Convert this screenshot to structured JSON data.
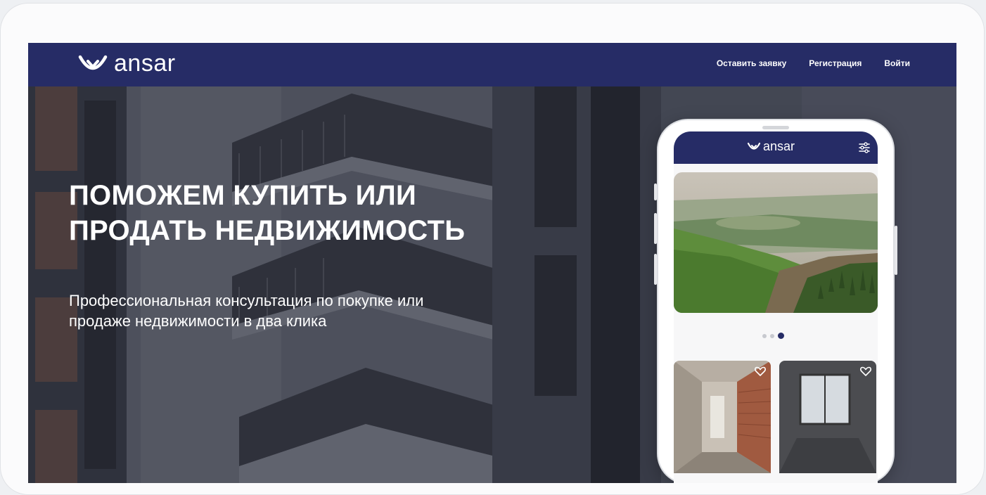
{
  "brand": {
    "name": "ansar",
    "accent": "#262c66"
  },
  "nav": {
    "items": [
      {
        "label": "Оставить заявку"
      },
      {
        "label": "Регистрация"
      },
      {
        "label": "Войти"
      }
    ]
  },
  "hero": {
    "title_line1": "ПОМОЖЕМ КУПИТЬ ИЛИ",
    "title_line2": "ПРОДАТЬ НЕДВИЖИМОСТЬ",
    "subtitle_line1": "Профессиональная консультация по покупке или",
    "subtitle_line2": "продаже недвижимости в два клика"
  },
  "phone_app": {
    "logo_text": "ansar",
    "carousel": {
      "slide_count": 3,
      "active_index": 2
    },
    "icons": [
      "filter-icon",
      "heart-icon"
    ]
  }
}
